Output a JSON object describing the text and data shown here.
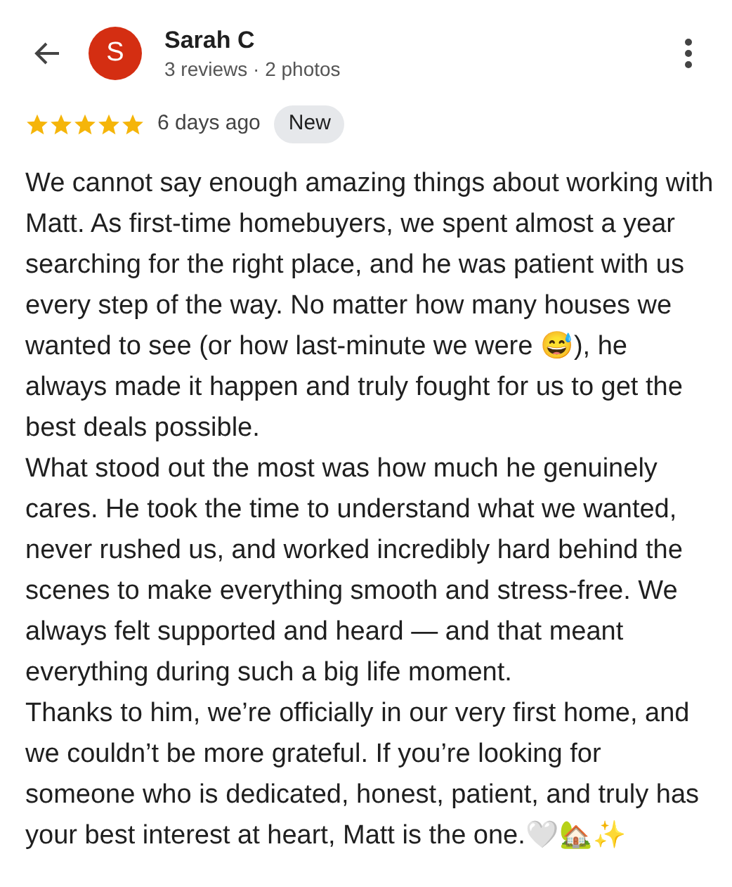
{
  "header": {
    "avatar_letter": "S",
    "name": "Sarah C",
    "meta": "3 reviews · 2 photos"
  },
  "review": {
    "stars": 5,
    "time": "6 days ago",
    "badge": "New",
    "paragraphs": [
      "We cannot say enough amazing things about working with Matt. As first-time homebuyers, we spent almost a year searching for the right place, and he was patient with us every step of the way. No matter how many houses we wanted to see (or how last-minute we were 😅), he always made it happen and truly fought for us to get the best deals possible.",
      "What stood out the most was how much he genuinely cares. He took the time to understand what we wanted, never rushed us, and worked incredibly hard behind the scenes to make everything smooth and stress-free. We always felt supported and heard — and that meant everything during such a big life moment.",
      "Thanks to him, we’re officially in our very first home, and we couldn’t be more grateful. If you’re looking for someone who is dedicated, honest, patient, and truly has your best interest at heart, Matt is the one.🤍🏡✨"
    ]
  }
}
